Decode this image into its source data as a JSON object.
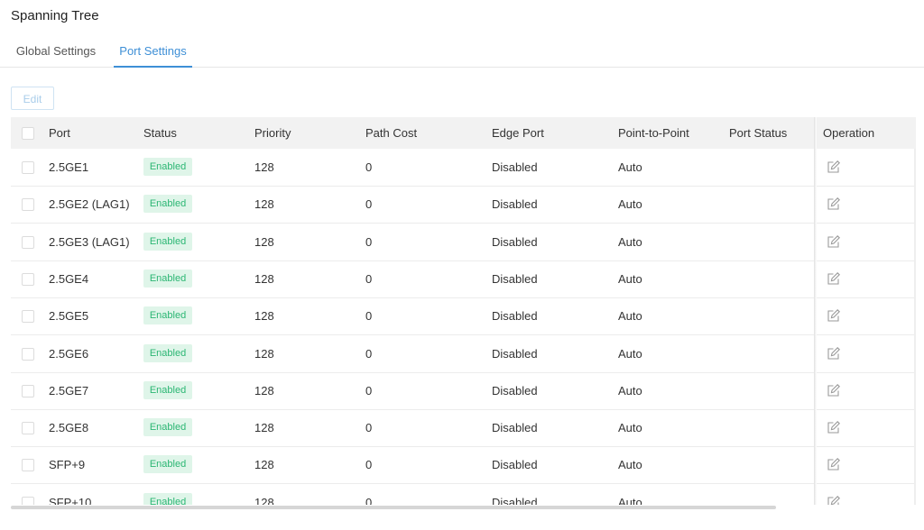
{
  "page": {
    "title": "Spanning Tree"
  },
  "tabs": [
    {
      "label": "Global Settings",
      "active": false
    },
    {
      "label": "Port Settings",
      "active": true
    }
  ],
  "toolbar": {
    "edit_label": "Edit"
  },
  "table": {
    "columns": {
      "port": "Port",
      "status": "Status",
      "priority": "Priority",
      "path_cost": "Path Cost",
      "edge_port": "Edge Port",
      "point_to_point": "Point-to-Point",
      "port_status": "Port Status",
      "operation": "Operation"
    },
    "rows": [
      {
        "port": "2.5GE1",
        "status": "Enabled",
        "priority": "128",
        "path_cost": "0",
        "edge_port": "Disabled",
        "point_to_point": "Auto",
        "port_status": ""
      },
      {
        "port": "2.5GE2 (LAG1)",
        "status": "Enabled",
        "priority": "128",
        "path_cost": "0",
        "edge_port": "Disabled",
        "point_to_point": "Auto",
        "port_status": ""
      },
      {
        "port": "2.5GE3 (LAG1)",
        "status": "Enabled",
        "priority": "128",
        "path_cost": "0",
        "edge_port": "Disabled",
        "point_to_point": "Auto",
        "port_status": ""
      },
      {
        "port": "2.5GE4",
        "status": "Enabled",
        "priority": "128",
        "path_cost": "0",
        "edge_port": "Disabled",
        "point_to_point": "Auto",
        "port_status": ""
      },
      {
        "port": "2.5GE5",
        "status": "Enabled",
        "priority": "128",
        "path_cost": "0",
        "edge_port": "Disabled",
        "point_to_point": "Auto",
        "port_status": ""
      },
      {
        "port": "2.5GE6",
        "status": "Enabled",
        "priority": "128",
        "path_cost": "0",
        "edge_port": "Disabled",
        "point_to_point": "Auto",
        "port_status": ""
      },
      {
        "port": "2.5GE7",
        "status": "Enabled",
        "priority": "128",
        "path_cost": "0",
        "edge_port": "Disabled",
        "point_to_point": "Auto",
        "port_status": ""
      },
      {
        "port": "2.5GE8",
        "status": "Enabled",
        "priority": "128",
        "path_cost": "0",
        "edge_port": "Disabled",
        "point_to_point": "Auto",
        "port_status": ""
      },
      {
        "port": "SFP+9",
        "status": "Enabled",
        "priority": "128",
        "path_cost": "0",
        "edge_port": "Disabled",
        "point_to_point": "Auto",
        "port_status": ""
      },
      {
        "port": "SFP+10",
        "status": "Enabled",
        "priority": "128",
        "path_cost": "0",
        "edge_port": "Disabled",
        "point_to_point": "Auto",
        "port_status": ""
      }
    ]
  },
  "icons": {
    "row_operation": "edit-icon"
  },
  "colors": {
    "accent": "#3e8fd6",
    "enabled_badge_bg": "#dff5e9",
    "enabled_badge_text": "#2bb673",
    "header_bg": "#f2f2f2"
  }
}
